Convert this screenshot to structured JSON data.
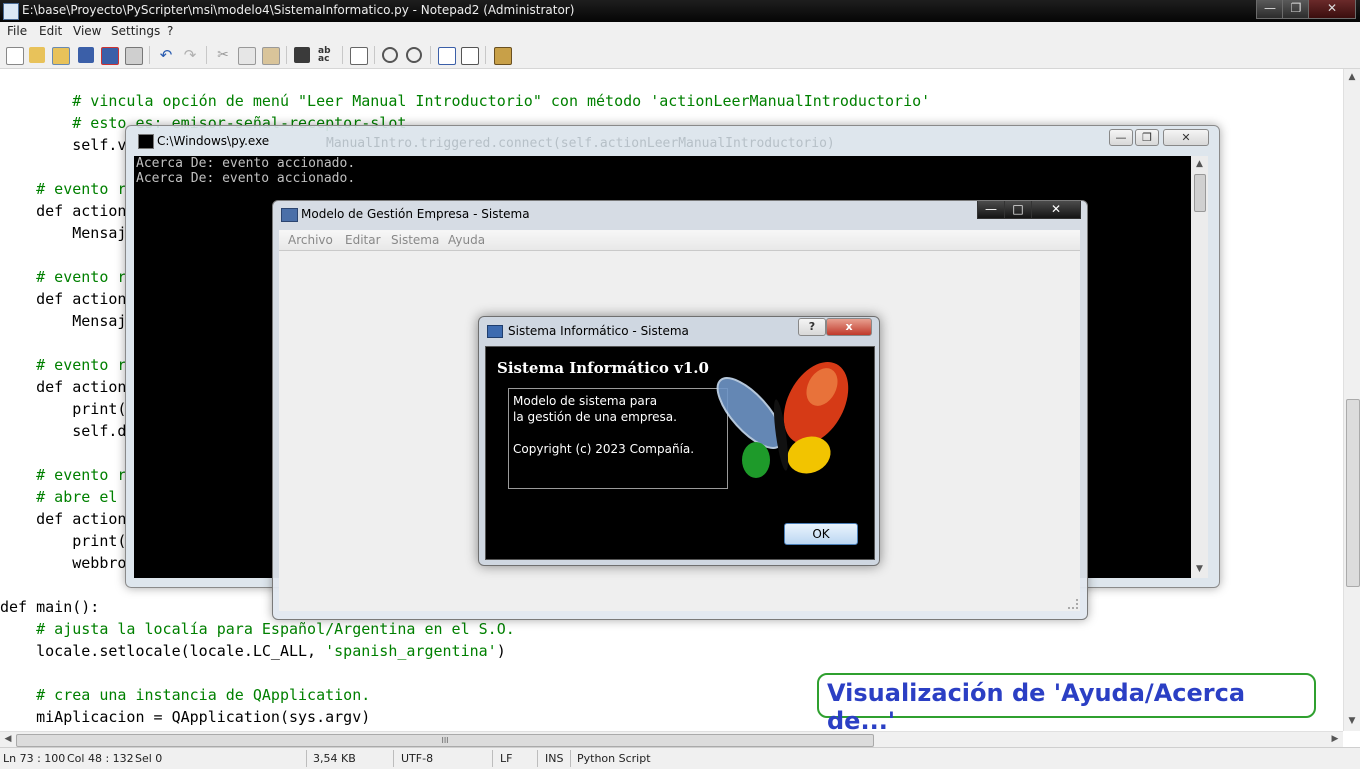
{
  "notepad": {
    "title": "E:\\base\\Proyecto\\PyScripter\\msi\\modelo4\\SistemaInformatico.py - Notepad2 (Administrator)",
    "menu": [
      "File",
      "Edit",
      "View",
      "Settings",
      "?"
    ],
    "toolbar_icons": [
      "new-file-icon",
      "open-file-icon",
      "browse-icon",
      "save-icon",
      "save-as-icon",
      "print-icon",
      "undo-icon",
      "redo-icon",
      "cut-icon",
      "copy-icon",
      "paste-icon",
      "find-icon",
      "replace-icon",
      "goto-icon",
      "zoom-in-icon",
      "zoom-out-icon",
      "settings-icon",
      "scheme-icon",
      "exit-icon"
    ],
    "code_lines": [
      {
        "text": "        # vincula opción de menú \"Leer Manual Introductorio\" con método 'actionLeerManualIntroductorio'",
        "kind": "comment"
      },
      {
        "text": "        # esto es: emisor-señal-receptor-slot",
        "kind": "comment"
      },
      {
        "text": "        self.v",
        "kind": "code"
      },
      {
        "text": "",
        "kind": "code"
      },
      {
        "text": "    # evento r",
        "kind": "comment"
      },
      {
        "text": "    def action",
        "kind": "code"
      },
      {
        "text": "        Mensaj",
        "kind": "code"
      },
      {
        "text": "",
        "kind": "code"
      },
      {
        "text": "    # evento r",
        "kind": "comment"
      },
      {
        "text": "    def action",
        "kind": "code"
      },
      {
        "text": "        Mensaj",
        "kind": "code"
      },
      {
        "text": "",
        "kind": "code"
      },
      {
        "text": "    # evento r",
        "kind": "comment"
      },
      {
        "text": "    def action",
        "kind": "code"
      },
      {
        "text": "        print(",
        "kind": "code"
      },
      {
        "text": "        self.d",
        "kind": "code"
      },
      {
        "text": "",
        "kind": "code"
      },
      {
        "text": "    # evento r",
        "kind": "comment"
      },
      {
        "text": "    # abre el",
        "kind": "comment"
      },
      {
        "text": "    def action",
        "kind": "code"
      },
      {
        "text": "        print(",
        "kind": "code"
      },
      {
        "text": "        webbro",
        "kind": "code"
      },
      {
        "text": "",
        "kind": "code"
      },
      {
        "text": "def main():",
        "kind": "code"
      },
      {
        "text": "    # ajusta la localía para Español/Argentina en el S.O.",
        "kind": "comment"
      },
      {
        "text": "    locale.setlocale(locale.LC_ALL, ",
        "kind": "code",
        "string": "'spanish_argentina'",
        "tail": ")"
      },
      {
        "text": "",
        "kind": "code"
      },
      {
        "text": "    # crea una instancia de QApplication.",
        "kind": "comment"
      },
      {
        "text": "    miAplicacion = QApplication(sys.argv)",
        "kind": "code"
      }
    ],
    "status": {
      "position": "Ln 73 : 100",
      "column": "Col 48 : 132",
      "selection": "Sel 0",
      "size": "3,54 KB",
      "encoding": "UTF-8",
      "line_ending": "LF",
      "insert_mode": "INS",
      "scheme": "Python Script"
    },
    "hscroll_grip": "III"
  },
  "console": {
    "title": "C:\\Windows\\py.exe",
    "lines": [
      "Acerca De: evento accionado.",
      "Acerca De: evento accionado."
    ],
    "ghost_text": "ManualIntro.triggered.connect(self.actionLeerManualIntroductorio)"
  },
  "qt_window": {
    "title": "Modelo de Gestión Empresa - Sistema",
    "menu": [
      "Archivo",
      "Editar",
      "Sistema",
      "Ayuda"
    ]
  },
  "about_dialog": {
    "title": "Sistema Informático - Sistema",
    "heading": "Sistema Informático v1.0",
    "text_lines": [
      "Modelo de sistema para",
      "la gestión de una empresa.",
      "",
      "Copyright (c) 2023 Compañía."
    ],
    "ok_label": "OK",
    "help_label": "?",
    "close_label": "x"
  },
  "annotation": "Visualización de 'Ayuda/Acerca de...'",
  "colors": {
    "comment": "#008000",
    "annotation_text": "#2b3fc4",
    "annotation_border": "#2fa02f"
  }
}
